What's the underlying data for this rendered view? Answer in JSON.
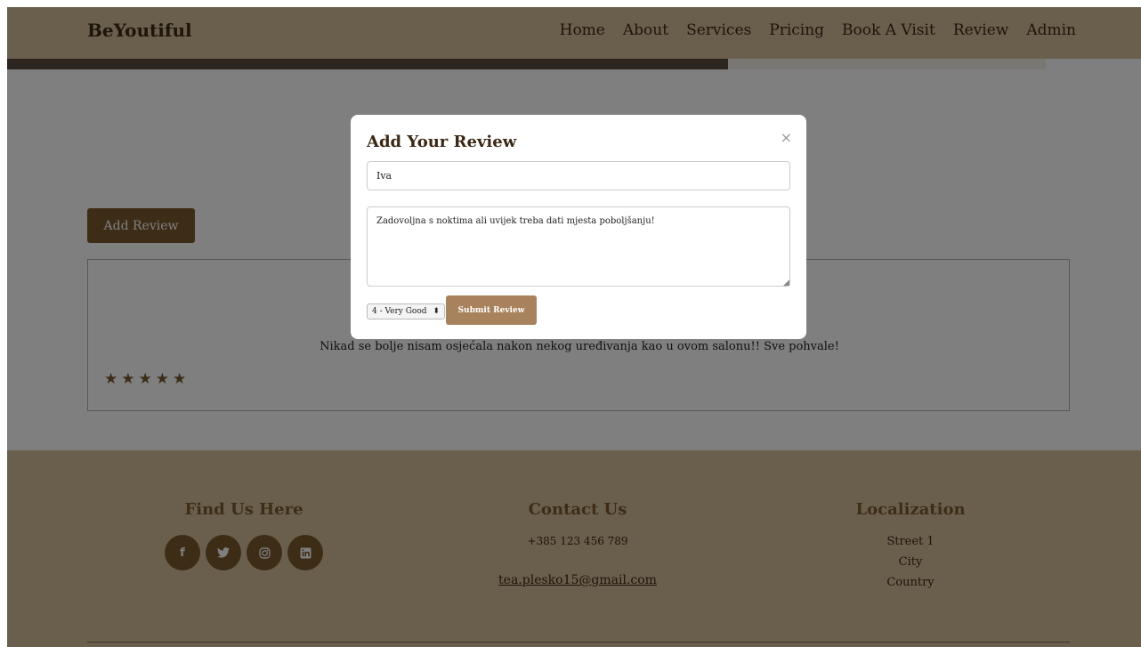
{
  "navbar": {
    "brand": "BeYoutiful",
    "links": [
      "Home",
      "About",
      "Services",
      "Pricing",
      "Book A Visit",
      "Review",
      "Admin"
    ]
  },
  "reviews": {
    "add_button": "Add Review",
    "items": [
      {
        "text": "Nikad se bolje nisam osjećala nakon nekog uređivanja kao u ovom salonu!! Sve pohvale!",
        "stars": 5
      }
    ]
  },
  "modal": {
    "title": "Add Your Review",
    "close": "×",
    "name_value": "Iva",
    "comment_value": "Zadovoljna s noktima ali uvijek treba dati mjesta poboljšanju!",
    "rating_selected": "4 - Very Good",
    "submit_label": "Submit Review"
  },
  "footer": {
    "find": {
      "heading": "Find Us Here",
      "socials": [
        "f",
        "t",
        "ig",
        "in"
      ]
    },
    "contact": {
      "heading": "Contact Us",
      "phone": "+385 123 456 789",
      "email": "tea.plesko15@gmail.com"
    },
    "localization": {
      "heading": "Localization",
      "lines": [
        "Street 1",
        "City",
        "Country"
      ]
    }
  },
  "colors": {
    "accent": "#7b5a2e",
    "header_bg": "#d4bf9a",
    "submit_bg": "#a8825c"
  }
}
